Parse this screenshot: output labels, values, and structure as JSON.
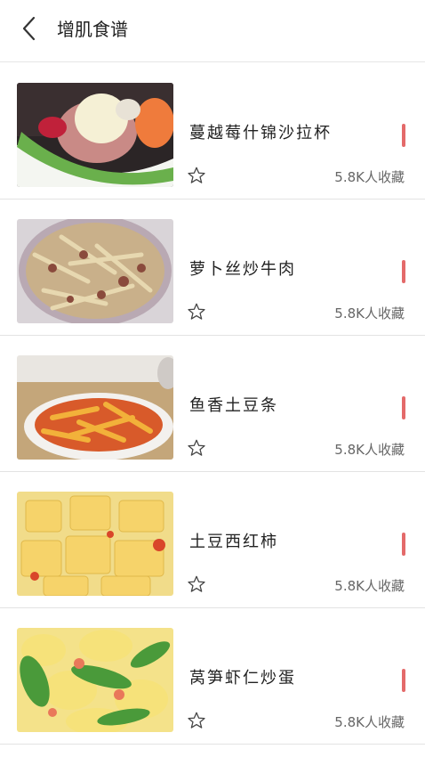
{
  "header": {
    "title": "增肌食谱",
    "back_icon": "chevron-left-icon"
  },
  "recipes": [
    {
      "name": "蔓越莓什锦沙拉杯",
      "favorites": "5.8K人收藏",
      "image": "cranberry salad cup",
      "accent": "#e46a6a"
    },
    {
      "name": "萝卜丝炒牛肉",
      "favorites": "5.8K人收藏",
      "image": "radish beef stir-fry",
      "accent": "#e46a6a"
    },
    {
      "name": "鱼香土豆条",
      "favorites": "5.8K人收藏",
      "image": "yuxiang potato strips",
      "accent": "#e46a6a"
    },
    {
      "name": "土豆西红柿",
      "favorites": "5.8K人收藏",
      "image": "potato tomato",
      "accent": "#e46a6a"
    },
    {
      "name": "莴笋虾仁炒蛋",
      "favorites": "5.8K人收藏",
      "image": "lettuce shrimp egg",
      "accent": "#e46a6a"
    }
  ]
}
